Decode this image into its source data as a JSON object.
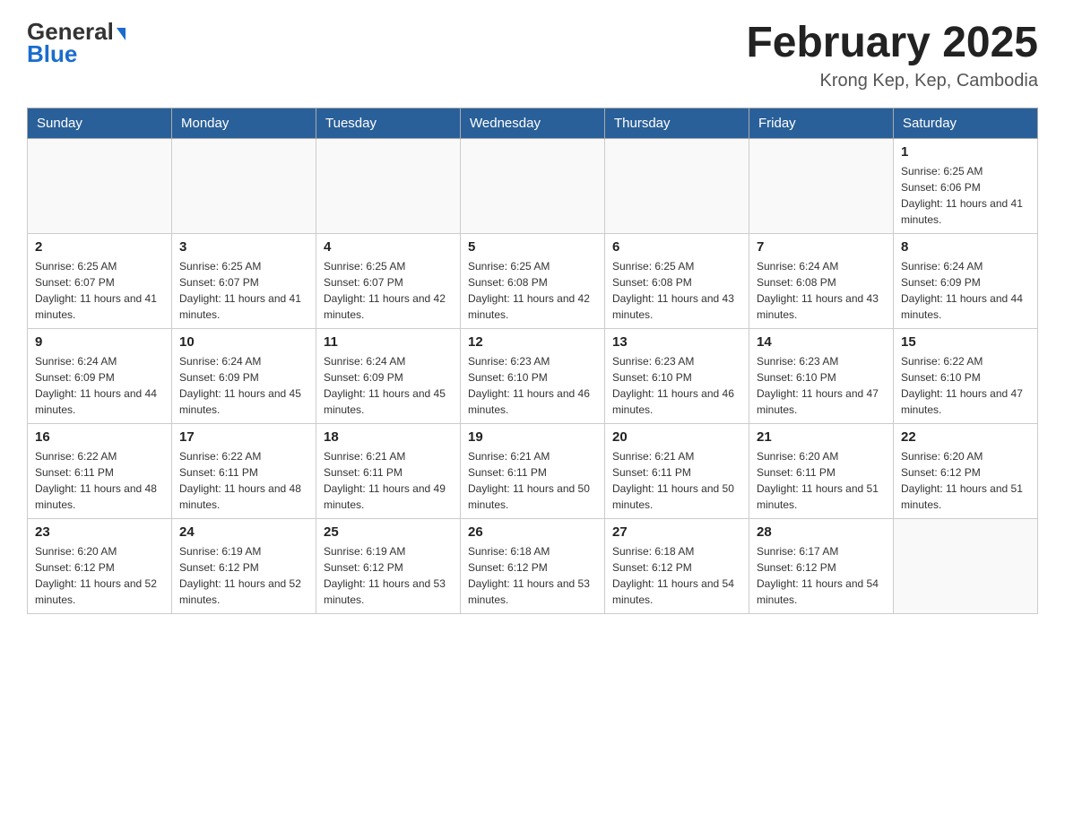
{
  "header": {
    "logo_general": "General",
    "logo_blue": "Blue",
    "month_title": "February 2025",
    "location": "Krong Kep, Kep, Cambodia"
  },
  "days_of_week": [
    "Sunday",
    "Monday",
    "Tuesday",
    "Wednesday",
    "Thursday",
    "Friday",
    "Saturday"
  ],
  "weeks": [
    {
      "days": [
        {
          "number": "",
          "info": ""
        },
        {
          "number": "",
          "info": ""
        },
        {
          "number": "",
          "info": ""
        },
        {
          "number": "",
          "info": ""
        },
        {
          "number": "",
          "info": ""
        },
        {
          "number": "",
          "info": ""
        },
        {
          "number": "1",
          "info": "Sunrise: 6:25 AM\nSunset: 6:06 PM\nDaylight: 11 hours and 41 minutes."
        }
      ]
    },
    {
      "days": [
        {
          "number": "2",
          "info": "Sunrise: 6:25 AM\nSunset: 6:07 PM\nDaylight: 11 hours and 41 minutes."
        },
        {
          "number": "3",
          "info": "Sunrise: 6:25 AM\nSunset: 6:07 PM\nDaylight: 11 hours and 41 minutes."
        },
        {
          "number": "4",
          "info": "Sunrise: 6:25 AM\nSunset: 6:07 PM\nDaylight: 11 hours and 42 minutes."
        },
        {
          "number": "5",
          "info": "Sunrise: 6:25 AM\nSunset: 6:08 PM\nDaylight: 11 hours and 42 minutes."
        },
        {
          "number": "6",
          "info": "Sunrise: 6:25 AM\nSunset: 6:08 PM\nDaylight: 11 hours and 43 minutes."
        },
        {
          "number": "7",
          "info": "Sunrise: 6:24 AM\nSunset: 6:08 PM\nDaylight: 11 hours and 43 minutes."
        },
        {
          "number": "8",
          "info": "Sunrise: 6:24 AM\nSunset: 6:09 PM\nDaylight: 11 hours and 44 minutes."
        }
      ]
    },
    {
      "days": [
        {
          "number": "9",
          "info": "Sunrise: 6:24 AM\nSunset: 6:09 PM\nDaylight: 11 hours and 44 minutes."
        },
        {
          "number": "10",
          "info": "Sunrise: 6:24 AM\nSunset: 6:09 PM\nDaylight: 11 hours and 45 minutes."
        },
        {
          "number": "11",
          "info": "Sunrise: 6:24 AM\nSunset: 6:09 PM\nDaylight: 11 hours and 45 minutes."
        },
        {
          "number": "12",
          "info": "Sunrise: 6:23 AM\nSunset: 6:10 PM\nDaylight: 11 hours and 46 minutes."
        },
        {
          "number": "13",
          "info": "Sunrise: 6:23 AM\nSunset: 6:10 PM\nDaylight: 11 hours and 46 minutes."
        },
        {
          "number": "14",
          "info": "Sunrise: 6:23 AM\nSunset: 6:10 PM\nDaylight: 11 hours and 47 minutes."
        },
        {
          "number": "15",
          "info": "Sunrise: 6:22 AM\nSunset: 6:10 PM\nDaylight: 11 hours and 47 minutes."
        }
      ]
    },
    {
      "days": [
        {
          "number": "16",
          "info": "Sunrise: 6:22 AM\nSunset: 6:11 PM\nDaylight: 11 hours and 48 minutes."
        },
        {
          "number": "17",
          "info": "Sunrise: 6:22 AM\nSunset: 6:11 PM\nDaylight: 11 hours and 48 minutes."
        },
        {
          "number": "18",
          "info": "Sunrise: 6:21 AM\nSunset: 6:11 PM\nDaylight: 11 hours and 49 minutes."
        },
        {
          "number": "19",
          "info": "Sunrise: 6:21 AM\nSunset: 6:11 PM\nDaylight: 11 hours and 50 minutes."
        },
        {
          "number": "20",
          "info": "Sunrise: 6:21 AM\nSunset: 6:11 PM\nDaylight: 11 hours and 50 minutes."
        },
        {
          "number": "21",
          "info": "Sunrise: 6:20 AM\nSunset: 6:11 PM\nDaylight: 11 hours and 51 minutes."
        },
        {
          "number": "22",
          "info": "Sunrise: 6:20 AM\nSunset: 6:12 PM\nDaylight: 11 hours and 51 minutes."
        }
      ]
    },
    {
      "days": [
        {
          "number": "23",
          "info": "Sunrise: 6:20 AM\nSunset: 6:12 PM\nDaylight: 11 hours and 52 minutes."
        },
        {
          "number": "24",
          "info": "Sunrise: 6:19 AM\nSunset: 6:12 PM\nDaylight: 11 hours and 52 minutes."
        },
        {
          "number": "25",
          "info": "Sunrise: 6:19 AM\nSunset: 6:12 PM\nDaylight: 11 hours and 53 minutes."
        },
        {
          "number": "26",
          "info": "Sunrise: 6:18 AM\nSunset: 6:12 PM\nDaylight: 11 hours and 53 minutes."
        },
        {
          "number": "27",
          "info": "Sunrise: 6:18 AM\nSunset: 6:12 PM\nDaylight: 11 hours and 54 minutes."
        },
        {
          "number": "28",
          "info": "Sunrise: 6:17 AM\nSunset: 6:12 PM\nDaylight: 11 hours and 54 minutes."
        },
        {
          "number": "",
          "info": ""
        }
      ]
    }
  ]
}
